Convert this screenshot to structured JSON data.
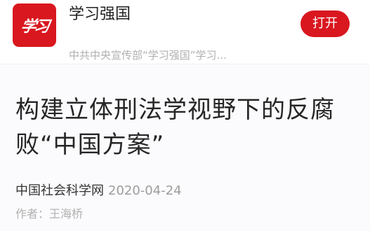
{
  "app_banner": {
    "logo_text": "学习",
    "name": "学习强国",
    "description": "中共中央宣传部“学习强国”学习...",
    "open_label": "打开"
  },
  "article": {
    "title": "构建立体刑法学视野下的反腐败“中国方案”",
    "source": "中国社会科学网",
    "date": "2020-04-24",
    "author": "作者：王海桥"
  },
  "colors": {
    "brand_red": "#d9171f",
    "text_primary": "#262626",
    "text_muted": "#b0b0b0"
  }
}
